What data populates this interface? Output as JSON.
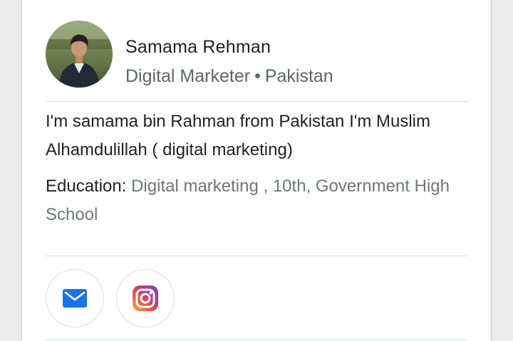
{
  "profile": {
    "name": "Samama Rehman",
    "title": "Digital Marketer",
    "separator": "•",
    "location": "Pakistan",
    "avatar_icon": "avatar-photo"
  },
  "bio": {
    "text": "I'm samama bin Rahman from Pakistan I'm Muslim Alhamdulillah ( digital marketing)"
  },
  "education": {
    "label": "Education:",
    "value": "Digital marketing , 10th, Government High School"
  },
  "actions": [
    {
      "icon": "email-icon",
      "color": "#1a73e8"
    },
    {
      "icon": "instagram-icon",
      "color": "#c13584"
    }
  ]
}
